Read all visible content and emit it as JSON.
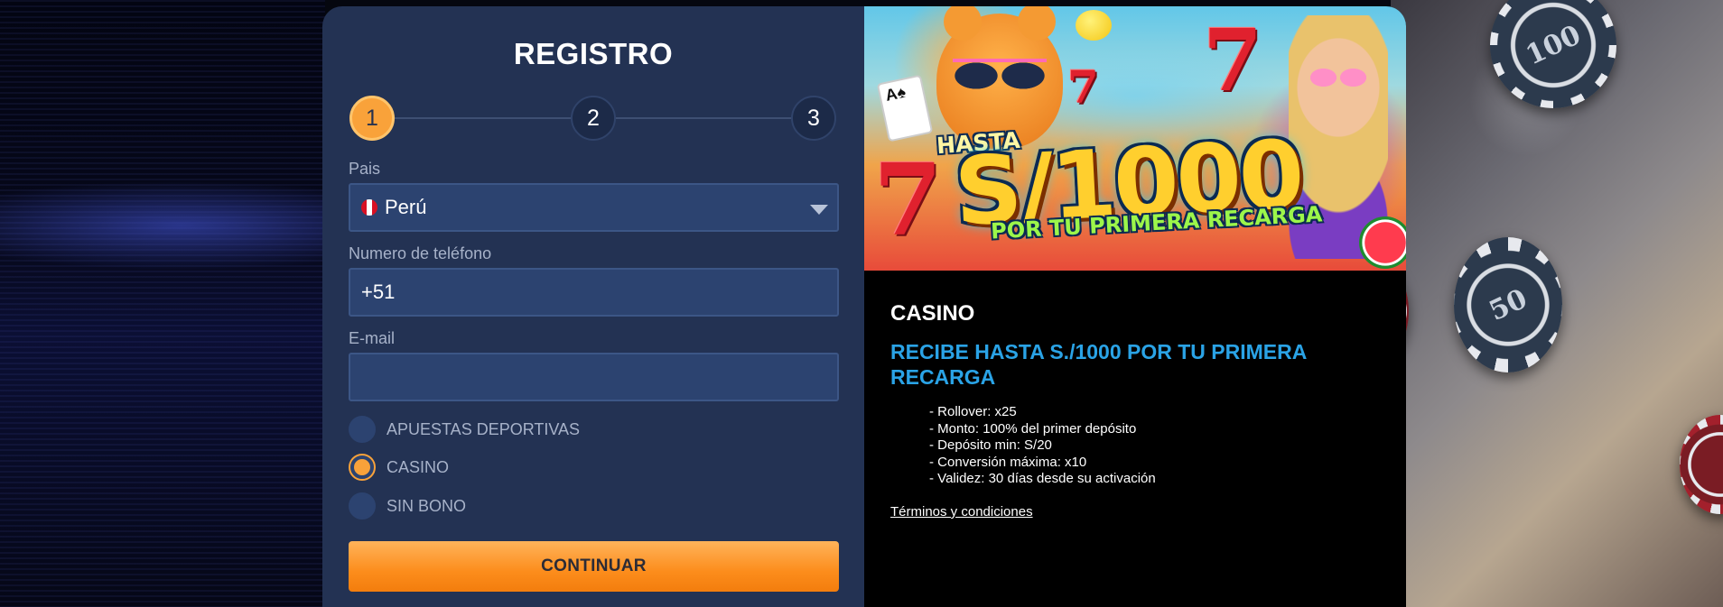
{
  "colors": {
    "panel_bg": "#233253",
    "field_bg": "#2c4370",
    "accent_orange": "#f9a23a",
    "headline_blue": "#2aa3e6",
    "promo_bg": "#000000"
  },
  "registration": {
    "title": "REGISTRO",
    "steps": [
      "1",
      "2",
      "3"
    ],
    "active_step": 1,
    "country": {
      "label": "Pais",
      "value": "Perú",
      "flag_icon": "peru-flag-icon"
    },
    "phone": {
      "label": "Numero de teléfono",
      "value": "+51"
    },
    "email": {
      "label": "E-mail",
      "value": ""
    },
    "bonus_options": [
      {
        "label": "APUESTAS DEPORTIVAS",
        "selected": false
      },
      {
        "label": "CASINO",
        "selected": true
      },
      {
        "label": "SIN BONO",
        "selected": false
      }
    ],
    "continue_label": "CONTINUAR"
  },
  "promo": {
    "banner": {
      "hasta": "HASTA",
      "amount": "S/1000",
      "subtitle": "POR TU PRIMERA RECARGA",
      "cards": "A♠"
    },
    "category": "CASINO",
    "headline": "RECIBE HASTA S./1000 POR TU PRIMERA RECARGA",
    "details": [
      "Rollover: x25",
      "Monto: 100% del primer depósito",
      "Depósito min: S/20",
      "Conversión máxima: x10",
      "Validez: 30 días desde su activación"
    ],
    "terms_label": "Términos y condiciones"
  },
  "background": {
    "chip_label": "50",
    "chip_label_top": "100"
  }
}
